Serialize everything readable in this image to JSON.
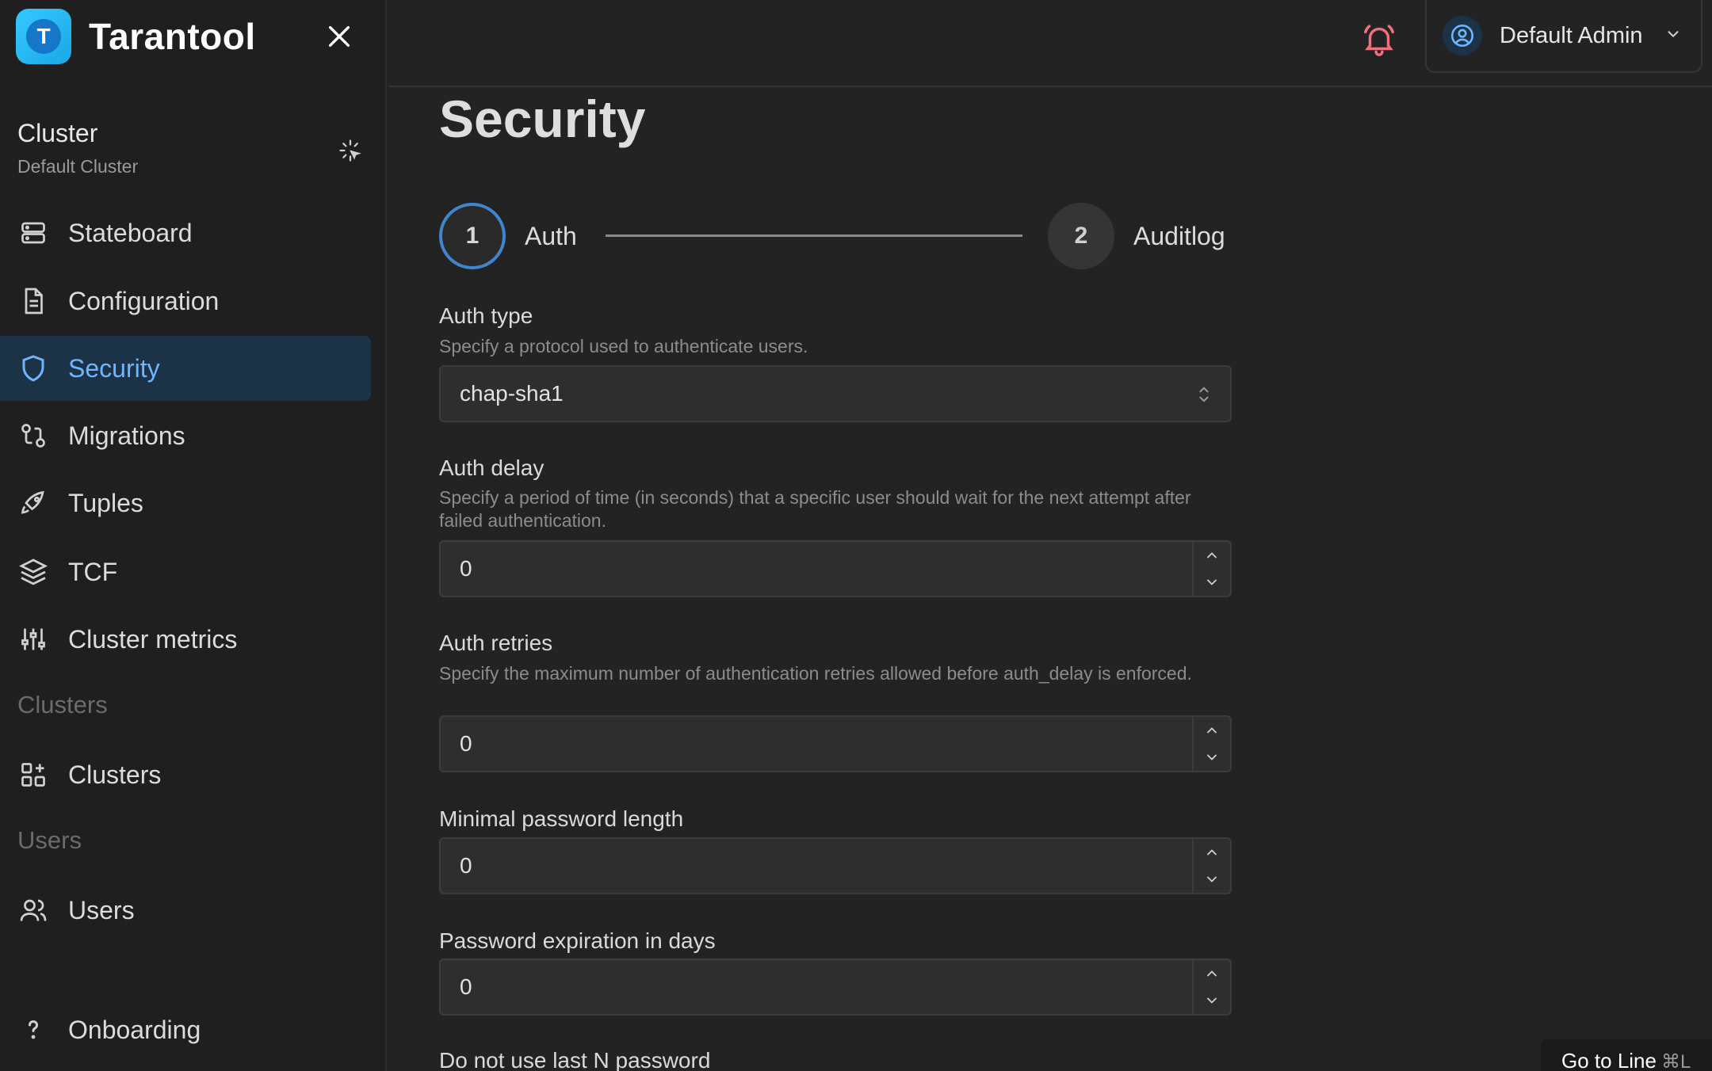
{
  "app": {
    "name": "Tarantool",
    "logo_letter": "T"
  },
  "cluster": {
    "title": "Cluster",
    "subtitle": "Default Cluster"
  },
  "nav": {
    "stateboard": "Stateboard",
    "configuration": "Configuration",
    "security": "Security",
    "migrations": "Migrations",
    "tuples": "Tuples",
    "tcf": "TCF",
    "cluster_metrics": "Cluster metrics",
    "clusters_section": "Clusters",
    "clusters": "Clusters",
    "users_section": "Users",
    "users": "Users",
    "onboarding": "Onboarding"
  },
  "header": {
    "user_name": "Default Admin"
  },
  "page": {
    "title": "Security"
  },
  "steps": [
    {
      "number": "1",
      "label": "Auth"
    },
    {
      "number": "2",
      "label": "Auditlog"
    }
  ],
  "form": {
    "auth_type": {
      "label": "Auth type",
      "description": "Specify a protocol used to authenticate users.",
      "value": "chap-sha1"
    },
    "auth_delay": {
      "label": "Auth delay",
      "description": "Specify a period of time (in seconds) that a specific user should wait for the next attempt after failed authentication.",
      "value": "0"
    },
    "auth_retries": {
      "label": "Auth retries",
      "description": "Specify the maximum number of authentication retries allowed before auth_delay is enforced.",
      "value": "0"
    },
    "min_password_length": {
      "label": "Minimal password length",
      "value": "0"
    },
    "password_expiration": {
      "label": "Password expiration in days",
      "value": "0"
    },
    "last_n_password": {
      "label": "Do not use last N password"
    }
  },
  "overlay": {
    "goto_line": "Go to Line",
    "shortcut": "⌘L"
  },
  "colors": {
    "accent": "#3f86cf",
    "active_bg": "#1c3247",
    "bell": "#f2707a"
  }
}
